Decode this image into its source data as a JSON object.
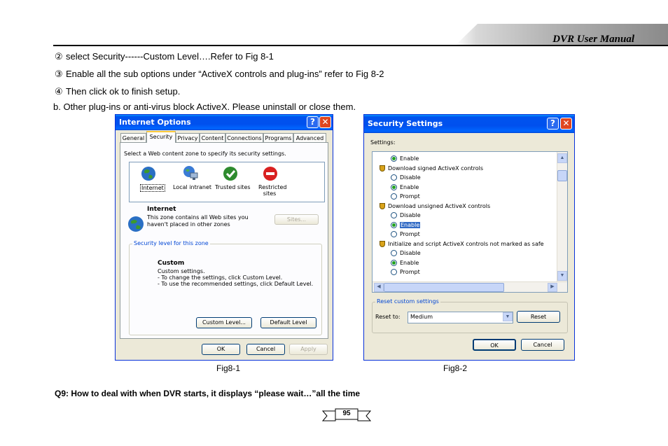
{
  "header": {
    "title": "DVR User Manual"
  },
  "steps": [
    {
      "num": "②",
      "text": "select Security------Custom Level….Refer to Fig 8-1"
    },
    {
      "num": "③",
      "text": "Enable all the sub options under “ActiveX controls and plug-ins” refer to Fig 8-2"
    },
    {
      "num": "④",
      "text": "Then click ok to finish setup."
    }
  ],
  "note_b": "b. Other plug-ins or anti-virus block ActiveX. Please uninstall or close them.",
  "fig1": {
    "title": "Internet Options",
    "tabs": [
      "General",
      "Security",
      "Privacy",
      "Content",
      "Connections",
      "Programs",
      "Advanced"
    ],
    "zone_prompt": "Select a Web content zone to specify its security settings.",
    "zones": [
      "Internet",
      "Local intranet",
      "Trusted sites",
      "Restricted sites"
    ],
    "zone_name": "Internet",
    "zone_desc_1": "This zone contains all Web sites you",
    "zone_desc_2": "haven't placed in other zones",
    "sites_button": "Sites...",
    "security_group": "Security level for this zone",
    "level_name": "Custom",
    "level_lines": [
      "Custom settings.",
      "- To change the settings, click Custom Level.",
      "- To use the recommended settings, click Default Level."
    ],
    "custom_button": "Custom Level...",
    "default_button": "Default Level",
    "ok": "OK",
    "cancel": "Cancel",
    "apply": "Apply",
    "caption": "Fig8-1"
  },
  "fig2": {
    "title": "Security Settings",
    "settings_label": "Settings:",
    "rows": [
      {
        "type": "radio",
        "label": "Enable",
        "checked": true
      },
      {
        "type": "header",
        "label": "Download signed ActiveX controls"
      },
      {
        "type": "radio",
        "label": "Disable",
        "checked": false
      },
      {
        "type": "radio",
        "label": "Enable",
        "checked": true
      },
      {
        "type": "radio",
        "label": "Prompt",
        "checked": false
      },
      {
        "type": "header",
        "label": "Download unsigned ActiveX controls"
      },
      {
        "type": "radio",
        "label": "Disable",
        "checked": false
      },
      {
        "type": "radio",
        "label": "Enable",
        "checked": true,
        "highlight": true
      },
      {
        "type": "radio",
        "label": "Prompt",
        "checked": false
      },
      {
        "type": "header",
        "label": "Initialize and script ActiveX controls not marked as safe"
      },
      {
        "type": "radio",
        "label": "Disable",
        "checked": false
      },
      {
        "type": "radio",
        "label": "Enable",
        "checked": true
      },
      {
        "type": "radio",
        "label": "Prompt",
        "checked": false
      }
    ],
    "reset_group": "Reset custom settings",
    "reset_to_label": "Reset to:",
    "reset_value": "Medium",
    "reset_button": "Reset",
    "ok": "OK",
    "cancel": "Cancel",
    "caption": "Fig8-2"
  },
  "q9": "Q9: How to deal with when DVR starts, it displays “please wait…”all the time",
  "page_number": "95"
}
